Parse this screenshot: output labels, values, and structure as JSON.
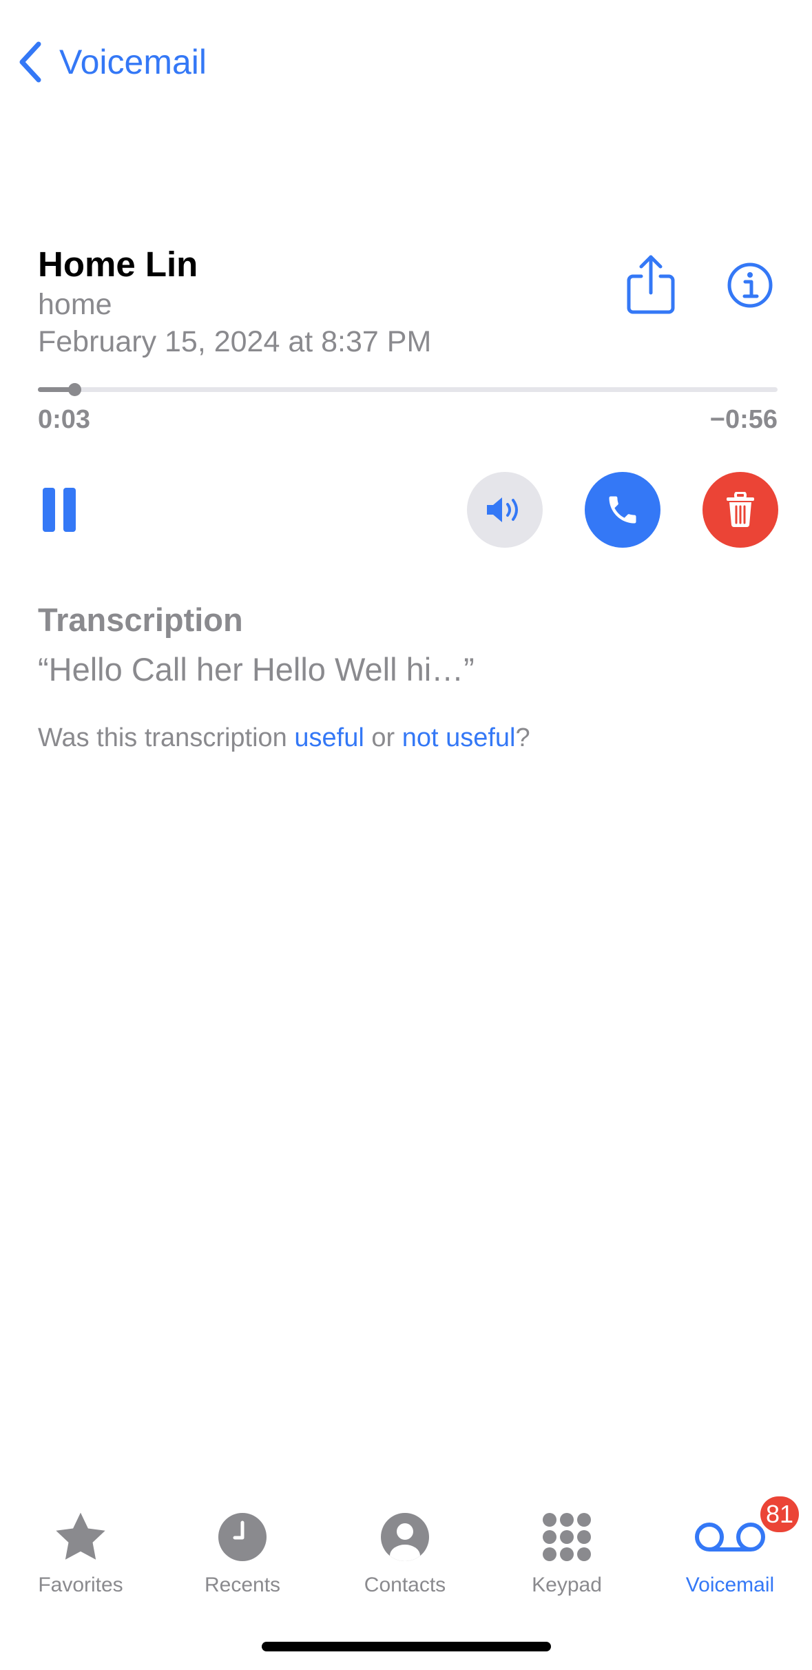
{
  "nav": {
    "back_label": "Voicemail"
  },
  "voicemail": {
    "name": "Home Lin",
    "label": "home",
    "date": "February 15, 2024 at 8:37 PM",
    "elapsed": "0:03",
    "remaining": "−0:56",
    "progress_fraction": 0.05
  },
  "transcription": {
    "title": "Transcription",
    "text": "“Hello Call her Hello Well hi…”",
    "feedback_prefix": "Was this transcription ",
    "useful": "useful",
    "feedback_or": " or ",
    "not_useful": "not useful",
    "feedback_suffix": "?"
  },
  "tabbar": {
    "tabs": [
      {
        "label": "Favorites",
        "icon": "star-icon"
      },
      {
        "label": "Recents",
        "icon": "clock-icon"
      },
      {
        "label": "Contacts",
        "icon": "person-circle-icon"
      },
      {
        "label": "Keypad",
        "icon": "keypad-icon"
      },
      {
        "label": "Voicemail",
        "icon": "voicemail-icon",
        "badge": "81",
        "active": true
      }
    ]
  },
  "colors": {
    "accent": "#3478f6",
    "destructive": "#eb4436",
    "secondary_text": "#8a8a8e",
    "control_gray": "#e5e5ea"
  }
}
